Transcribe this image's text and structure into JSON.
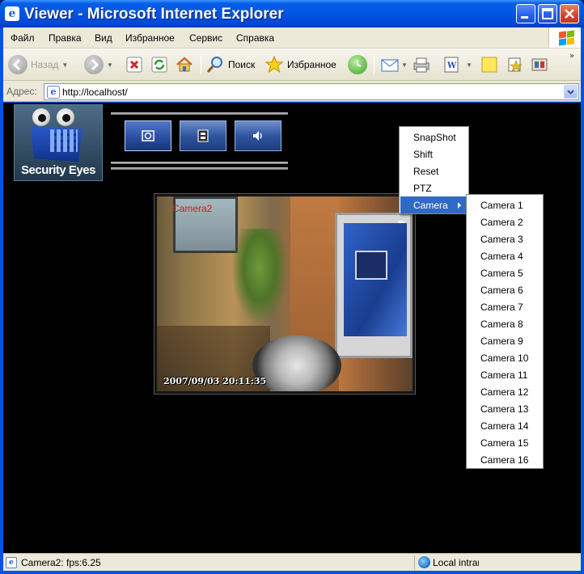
{
  "window": {
    "title": "Viewer - Microsoft Internet Explorer"
  },
  "menubar": {
    "items": [
      "Файл",
      "Правка",
      "Вид",
      "Избранное",
      "Сервис",
      "Справка"
    ]
  },
  "toolbar": {
    "back_label": "Назад",
    "search_label": "Поиск",
    "favorites_label": "Избранное"
  },
  "address": {
    "label": "Адрес:",
    "url": "http://localhost/"
  },
  "logo": {
    "text": "Security Eyes"
  },
  "video": {
    "camera_label": "Camera2",
    "timestamp": "2007/09/03 20:11:35"
  },
  "context_menu": {
    "items": [
      "SnapShot",
      "Shift",
      "Reset",
      "PTZ",
      "Camera"
    ],
    "selected": "Camera"
  },
  "camera_submenu": {
    "items": [
      "Camera 1",
      "Camera 2",
      "Camera 3",
      "Camera 4",
      "Camera 5",
      "Camera 6",
      "Camera 7",
      "Camera 8",
      "Camera 9",
      "Camera 10",
      "Camera 11",
      "Camera 12",
      "Camera 13",
      "Camera 14",
      "Camera 15",
      "Camera 16"
    ]
  },
  "status": {
    "text": "Camera2: fps:6.25",
    "zone": "Local intranet"
  },
  "colors": {
    "titlebar": "#0055e5",
    "selection": "#316ac5",
    "content_bg": "#000000",
    "camera_label": "#d31b1b"
  }
}
